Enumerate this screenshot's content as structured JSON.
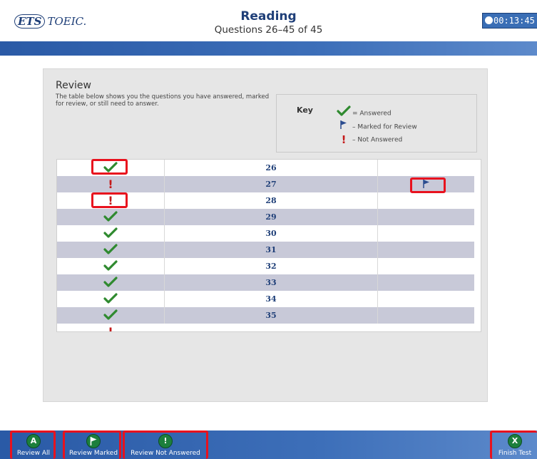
{
  "header": {
    "logo_ets": "ETS",
    "logo_text": "TOEIC.",
    "section_title": "Reading",
    "section_subtitle": "Questions 26–45 of 45",
    "timer": "00:13:45"
  },
  "review": {
    "title": "Review",
    "description": "The table below shows you the questions you have answered, marked for review, or still need to answer.",
    "key_label": "Key",
    "key_answered": "= Answered",
    "key_marked": "– Marked for Review",
    "key_not_answered": "– Not Answered"
  },
  "questions": [
    {
      "number": "26",
      "status": "answered",
      "marked": false
    },
    {
      "number": "27",
      "status": "not_answered",
      "marked": true
    },
    {
      "number": "28",
      "status": "not_answered",
      "marked": false
    },
    {
      "number": "29",
      "status": "answered",
      "marked": false
    },
    {
      "number": "30",
      "status": "answered",
      "marked": false
    },
    {
      "number": "31",
      "status": "answered",
      "marked": false
    },
    {
      "number": "32",
      "status": "answered",
      "marked": false
    },
    {
      "number": "33",
      "status": "answered",
      "marked": false
    },
    {
      "number": "34",
      "status": "answered",
      "marked": false
    },
    {
      "number": "35",
      "status": "answered",
      "marked": false
    }
  ],
  "nav": {
    "review_all": {
      "label": "Review All",
      "icon_letter": "A"
    },
    "review_marked": {
      "label": "Review Marked"
    },
    "review_not_answered": {
      "label": "Review Not Answered",
      "icon_letter": "!"
    },
    "finish_test": {
      "label": "Finish Test",
      "icon_letter": "X"
    }
  },
  "colors": {
    "header_bar": "#3d6fb9",
    "check_green": "#2f8a2f",
    "excl_red": "#c41a1a",
    "flag_blue": "#2b4c8f",
    "highlight_red": "#e8121e",
    "alt_row": "#c8c9d8"
  }
}
